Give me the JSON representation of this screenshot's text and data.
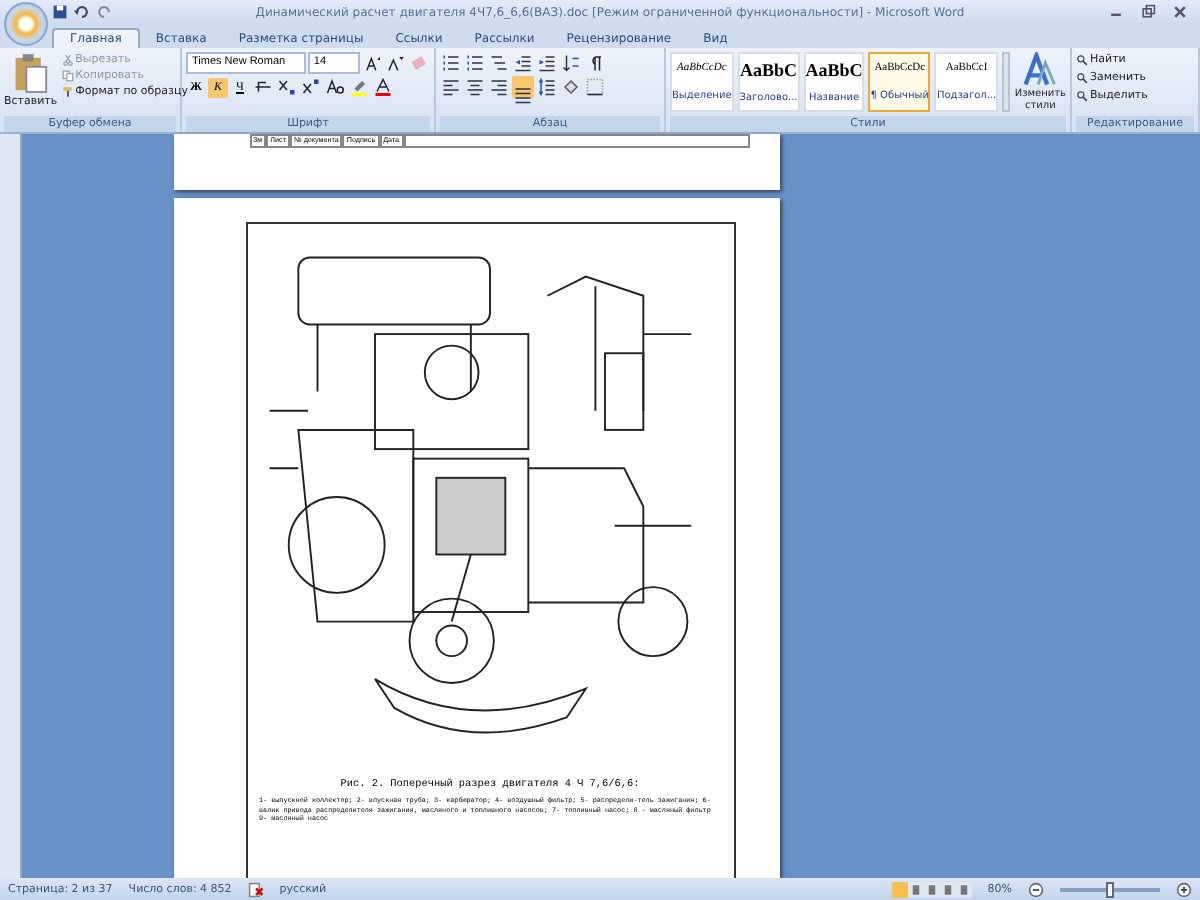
{
  "window": {
    "title": "Динамический расчет двигателя 4Ч7,6_6,6(ВАЗ).doc [Режим ограниченной функциональности] - Microsoft Word"
  },
  "tabs": [
    {
      "label": "Главная",
      "selected": true
    },
    {
      "label": "Вставка",
      "selected": false
    },
    {
      "label": "Разметка страницы",
      "selected": false
    },
    {
      "label": "Ссылки",
      "selected": false
    },
    {
      "label": "Рассылки",
      "selected": false
    },
    {
      "label": "Рецензирование",
      "selected": false
    },
    {
      "label": "Вид",
      "selected": false
    }
  ],
  "clipboard": {
    "paste": "Вставить",
    "cut": "Вырезать",
    "copy": "Копировать",
    "format": "Формат по образцу",
    "group": "Буфер обмена"
  },
  "font": {
    "name": "Times New Roman",
    "size": "14",
    "bold_label": "Ж",
    "italic_label": "К",
    "italic_on": true,
    "underline_label": "Ч",
    "group": "Шрифт"
  },
  "paragraph": {
    "group": "Абзац",
    "justify_on": true
  },
  "styles": {
    "items": [
      {
        "sample": "AaBbCcDc",
        "name": "Выделение",
        "selected": false,
        "kind": "italic"
      },
      {
        "sample": "AaBbC",
        "name": "Заголово...",
        "selected": false,
        "kind": "heading"
      },
      {
        "sample": "AaBbC",
        "name": "Название",
        "selected": false,
        "kind": "heading"
      },
      {
        "sample": "AaBbCcDc",
        "name": "¶ Обычный",
        "selected": true,
        "kind": "normal"
      },
      {
        "sample": "AaBbCcI",
        "name": "Подзагол...",
        "selected": false,
        "kind": "normal"
      }
    ],
    "change": "Изменить стили",
    "group": "Стили"
  },
  "editing": {
    "items": [
      "Найти",
      "Заменить",
      "Выделить"
    ],
    "group": "Редактирование"
  },
  "stamp_cells": [
    "Зм",
    "Лист",
    "№ документа",
    "Подпись",
    "Дата"
  ],
  "figure": {
    "caption": "Рис. 2. Поперечный разрез двигателя 4 Ч 7,6/6,6:",
    "legend": "1- выпускной коллектор; 2- впускная труба; 3- карбюратор; 4- воздушный фильтр; 5- распредели-тель зажигания; 6- валик привода распределителя зажигания, масляного и топливного насосов; 7- топливный насос; 8 - масляный фильтр 9- масляный насос"
  },
  "status_bar": {
    "page": "Страница: 2 из 37",
    "words": "Число слов: 4 852",
    "language": "русский",
    "zoom": "80%",
    "zoom_slider": {
      "level": 0.5
    }
  }
}
